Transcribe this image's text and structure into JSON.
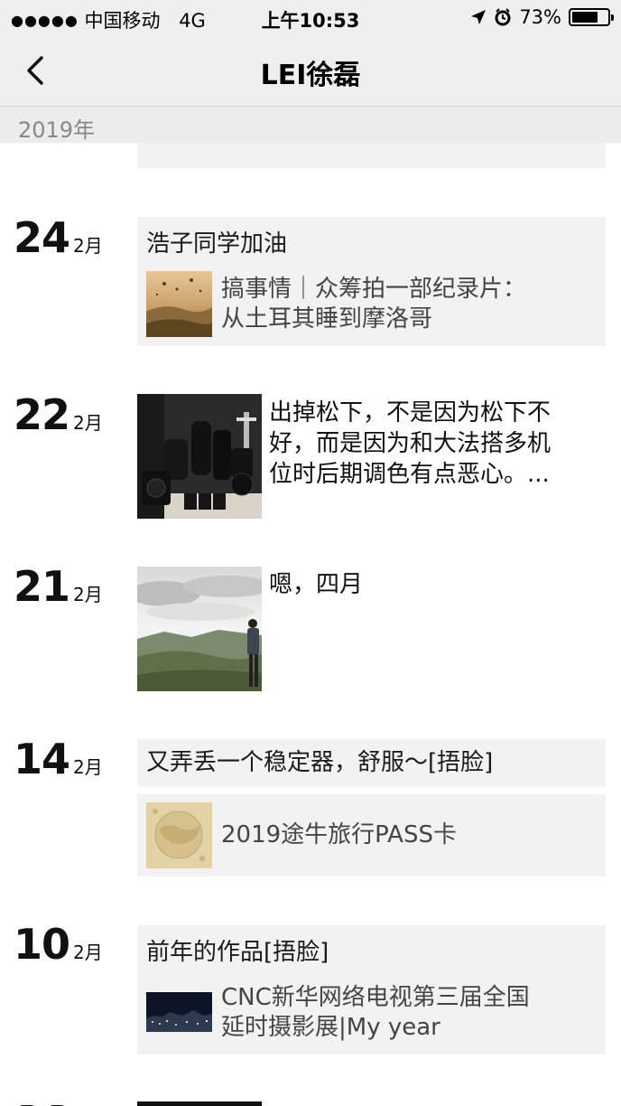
{
  "status": {
    "carrier": "中国移动",
    "network": "4G",
    "time": "上午10:53",
    "battery": "73%",
    "battery_level": 0.73,
    "icons": [
      "signal-dots-icon",
      "location-arrow-icon",
      "alarm-icon",
      "battery-icon"
    ]
  },
  "nav": {
    "title": "LEI徐磊",
    "back_icon": "chevron-left-icon"
  },
  "year": "2019年",
  "posts": [
    {
      "day": "24",
      "month": "2月",
      "text": "浩子同学加油",
      "share_line1": "搞事情｜众筹拍一部纪录片：",
      "share_line2": "从土耳其睡到摩洛哥"
    },
    {
      "day": "22",
      "month": "2月",
      "text_line1": "出掉松下，不是因为松下不",
      "text_line2": "好，而是因为和大法搭多机",
      "text_line3": "位时后期调色有点恶心。..."
    },
    {
      "day": "21",
      "month": "2月",
      "text": "嗯，四月"
    },
    {
      "day": "14",
      "month": "2月",
      "text": "又弄丢一个稳定器，舒服～[捂脸]",
      "share_line1": "2019途牛旅行PASS卡"
    },
    {
      "day": "10",
      "month": "2月",
      "text": "前年的作品[捂脸]",
      "share_line1": "CNC新华网络电视第三届全国",
      "share_line2": "延时摄影展|My year"
    }
  ],
  "colors": {
    "card_bg": "#f2f2f2",
    "bar_bg": "#efefef",
    "text": "#111111",
    "muted": "#888888"
  }
}
